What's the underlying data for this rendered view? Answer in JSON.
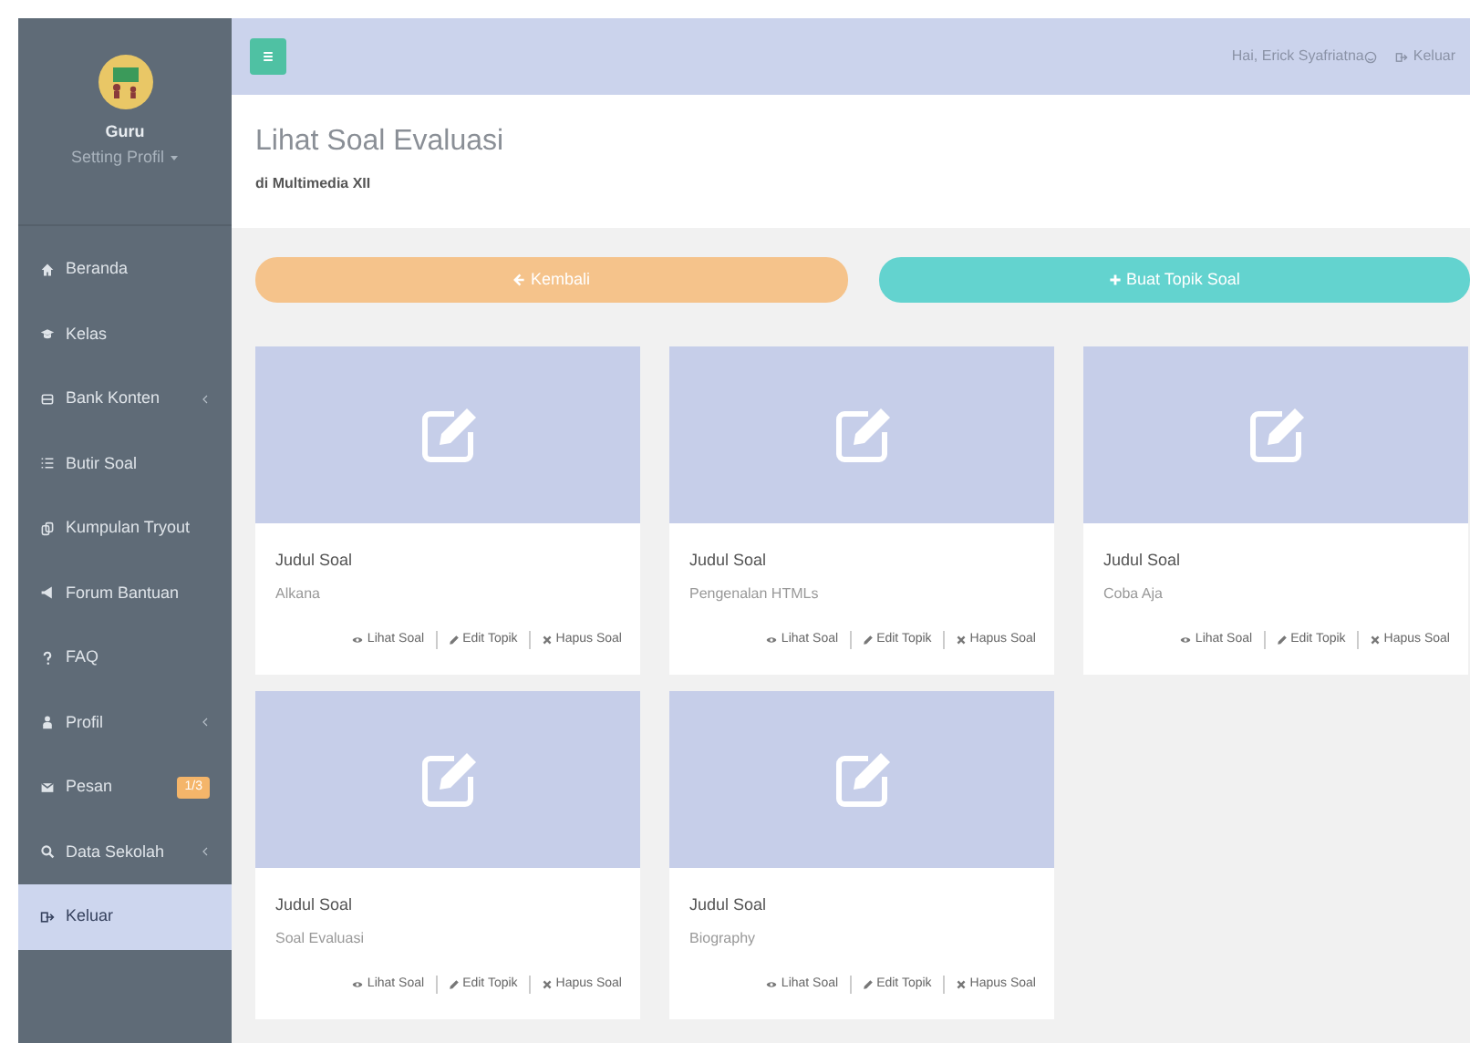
{
  "sidebar": {
    "user": {
      "role": "Guru",
      "menu": "Setting Profil"
    },
    "items": [
      {
        "label": "Beranda",
        "submenu": false,
        "selected": false
      },
      {
        "label": "Kelas",
        "submenu": false,
        "selected": false
      },
      {
        "label": "Bank Konten",
        "submenu": true,
        "selected": false
      },
      {
        "label": "Butir Soal",
        "submenu": false,
        "selected": false
      },
      {
        "label": "Kumpulan Tryout",
        "submenu": false,
        "selected": false
      },
      {
        "label": "Forum Bantuan",
        "submenu": false,
        "selected": false
      },
      {
        "label": "FAQ",
        "submenu": false,
        "selected": false
      },
      {
        "label": "Profil",
        "submenu": true,
        "selected": false
      },
      {
        "label": "Pesan",
        "submenu": false,
        "selected": false,
        "badge": "1/3"
      },
      {
        "label": "Data Sekolah",
        "submenu": true,
        "selected": false
      },
      {
        "label": "Keluar",
        "submenu": false,
        "selected": true
      }
    ]
  },
  "topbar": {
    "greeting": "Hai, Erick Syafriatna",
    "logout": "Keluar"
  },
  "header": {
    "title": "Lihat Soal Evaluasi",
    "subtitle": "di Multimedia XII"
  },
  "buttons": [
    {
      "kind": "back",
      "label": "Kembali"
    },
    {
      "kind": "add",
      "label": "Buat Topik Soal"
    }
  ],
  "cards": [
    {
      "heading": "Judul Soal",
      "title": "Alkana",
      "actions": [
        "Lihat Soal",
        "Edit Topik",
        "Hapus Soal"
      ]
    },
    {
      "heading": "Judul Soal",
      "title": "Pengenalan HTMLs",
      "actions": [
        "Lihat Soal",
        "Edit Topik",
        "Hapus Soal"
      ]
    },
    {
      "heading": "Judul Soal",
      "title": "Coba Aja",
      "actions": [
        "Lihat Soal",
        "Edit Topik",
        "Hapus Soal"
      ]
    },
    {
      "heading": "Judul Soal",
      "title": "Soal Evaluasi",
      "actions": [
        "Lihat Soal",
        "Edit Topik",
        "Hapus Soal"
      ]
    },
    {
      "heading": "Judul Soal",
      "title": "Biography",
      "actions": [
        "Lihat Soal",
        "Edit Topik",
        "Hapus Soal"
      ]
    }
  ]
}
